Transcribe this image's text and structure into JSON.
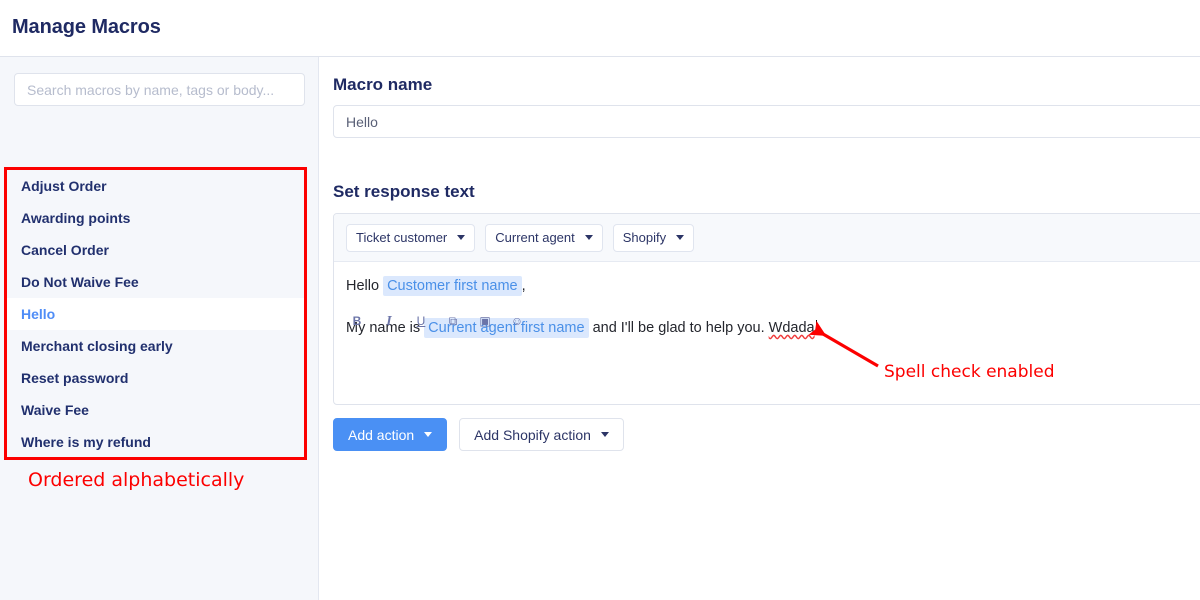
{
  "header": {
    "title": "Manage Macros"
  },
  "sidebar": {
    "search": {
      "placeholder": "Search macros by name, tags or body...",
      "value": ""
    },
    "macros": [
      {
        "label": "Adjust Order",
        "selected": false
      },
      {
        "label": "Awarding points",
        "selected": false
      },
      {
        "label": "Cancel Order",
        "selected": false
      },
      {
        "label": "Do Not Waive Fee",
        "selected": false
      },
      {
        "label": "Hello",
        "selected": true
      },
      {
        "label": "Merchant closing early",
        "selected": false
      },
      {
        "label": "Reset password",
        "selected": false
      },
      {
        "label": "Waive Fee",
        "selected": false
      },
      {
        "label": "Where is my refund",
        "selected": false
      }
    ]
  },
  "main": {
    "macro_name_label": "Macro name",
    "macro_name_value": "Hello",
    "macro_name_placeholder": "Macro name",
    "response_label": "Set response text",
    "editor": {
      "dropdowns": [
        {
          "label": "Ticket customer"
        },
        {
          "label": "Current agent"
        },
        {
          "label": "Shopify"
        }
      ],
      "line1_pre": "Hello",
      "line1_token": "Customer first name",
      "line1_post": ",",
      "line2_pre": "My name is",
      "line2_token": "Current agent first name",
      "line2_mid": "and I'll be glad to help you.",
      "line2_misspelled": "Wdada",
      "format_icons": [
        {
          "name": "bold-icon",
          "glyph": "B"
        },
        {
          "name": "italic-icon",
          "glyph": "I"
        },
        {
          "name": "underline-icon",
          "glyph": "U"
        },
        {
          "name": "link-icon",
          "glyph": "⧉"
        },
        {
          "name": "image-icon",
          "glyph": "▣"
        },
        {
          "name": "emoji-icon",
          "glyph": "☺"
        }
      ]
    },
    "actions": {
      "add_action": "Add action",
      "add_shopify_action": "Add Shopify action"
    }
  },
  "annotations": {
    "ordered_alphabetically": "Ordered alphabetically",
    "spell_check_enabled": "Spell check enabled",
    "color": "#fc0000"
  },
  "colors": {
    "accent_blue": "#4a90f4",
    "selected_text": "#4f8df7",
    "token_bg": "#dbe8fd",
    "token_text": "#4a90e8",
    "heading": "#1f2a63",
    "annotation_red": "#fc0000",
    "sidebar_bg": "#f5f7fb"
  }
}
